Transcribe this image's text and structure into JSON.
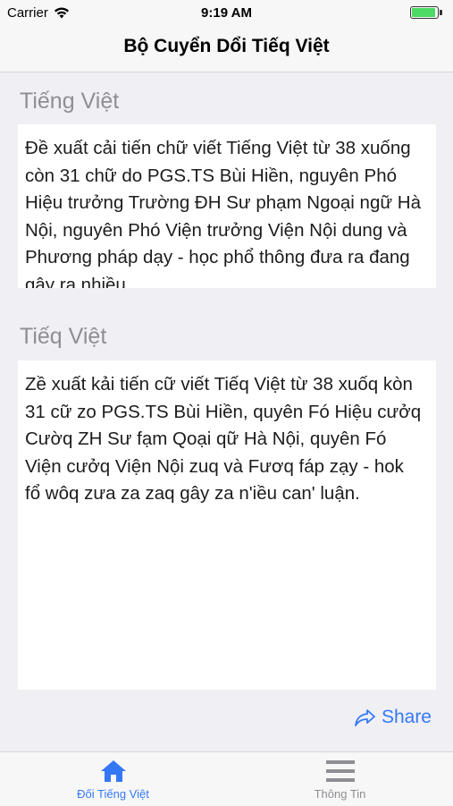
{
  "status_bar": {
    "carrier": "Carrier",
    "time": "9:19 AM",
    "icons": [
      "wifi-icon",
      "battery-icon"
    ],
    "battery_color": "#4cd964"
  },
  "nav": {
    "title": "Bộ Cuyển Dổi Tiếq Việt"
  },
  "input_section": {
    "label": "Tiếng Việt",
    "text": "Đề xuất cải tiến chữ viết Tiếng Việt từ 38 xuống còn 31 chữ do PGS.TS Bùi Hiền, nguyên Phó Hiệu trưởng Trường ĐH Sư phạm Ngoại ngữ Hà Nội, nguyên Phó Viện trưởng Viện Nội dung và Phương pháp dạy - học phổ thông đưa ra đang gây ra nhiều"
  },
  "output_section": {
    "label": "Tiếq Việt",
    "text": "Zề xuất kải tiến cữ viết Tiếq Việt từ 38 xuốq kòn 31 cữ zo PGS.TS Bùi Hiền, quyên Fó Hiệu cưởq Cườq ZH Sư fạm Qoại qữ Hà Nội, quyên Fó Viện cưởq Viện Nội zuq và Fươq fáp zạy - hok fổ wôq zưa za zaq gây za n'iều can' luận."
  },
  "actions": {
    "share_label": "Share",
    "share_icon": "share-arrow-icon"
  },
  "tab_bar": {
    "tabs": [
      {
        "label": "Đối Tiếng Việt",
        "icon": "home-icon",
        "selected": true
      },
      {
        "label": "Thông Tin",
        "icon": "menu-icon",
        "selected": false
      }
    ]
  },
  "colors": {
    "accent": "#3478f6",
    "background": "#efeff4",
    "label_gray": "#8e8e93"
  }
}
